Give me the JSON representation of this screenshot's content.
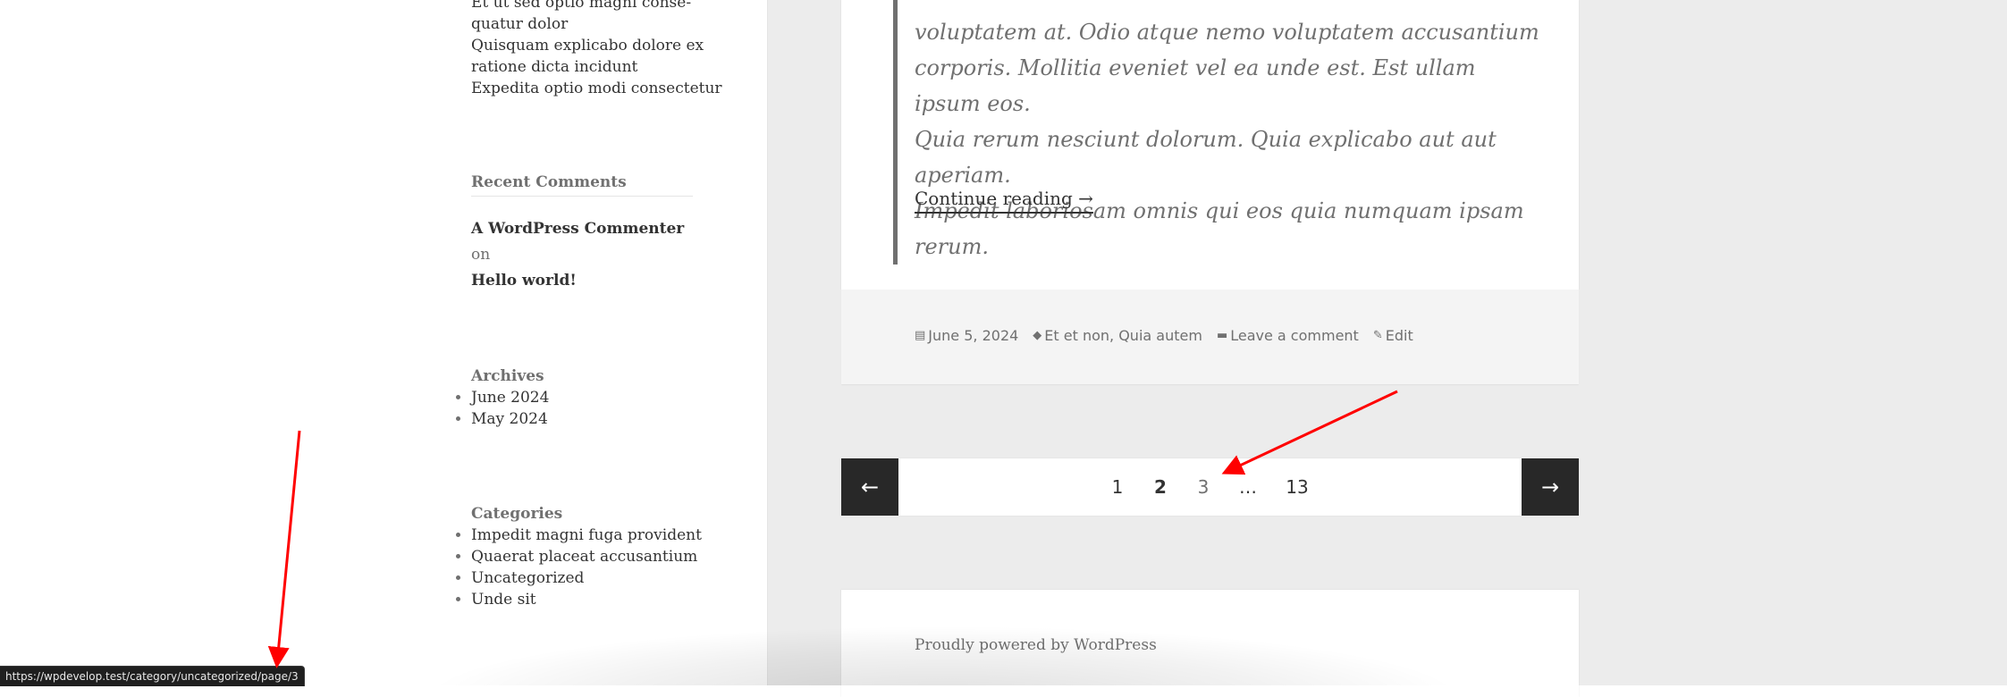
{
  "sidebar": {
    "recent_posts_tail": [
      "Et ut sed optio magni conse-",
      "quatur dolor",
      "Quisquam explicabo dolore ex",
      "ratione dicta incidunt",
      "Expedita optio modi consectetur"
    ],
    "recent_comments": {
      "title": "Recent Comments",
      "author": "A WordPress Commenter",
      "on_label": "on",
      "post": "Hello world!"
    },
    "archives": {
      "title": "Archives",
      "items": [
        "June 2024",
        "May 2024"
      ]
    },
    "categories": {
      "title": "Categories",
      "items": [
        "Impedit magni fuga provident",
        "Quaerat placeat accusantium",
        "Uncategorized",
        "Unde sit"
      ]
    }
  },
  "post": {
    "quote_lines": [
      "voluptatem at. Odio atque nemo voluptatem accusantium",
      "corporis. Mollitia eveniet vel ea unde est. Est ullam ipsum eos.",
      "Quia rerum nesciunt dolorum. Quia explicabo aut aut aperiam.",
      "Impedit laboriosam omnis qui eos quia numquam ipsam rerum."
    ],
    "continue_label": "Continue reading →",
    "meta": {
      "date": "June 5, 2024",
      "tags": "Et et non, Quia autem",
      "comments": "Leave a comment",
      "edit": "Edit",
      "icons": {
        "date": "calendar-icon",
        "tags": "tag-icon",
        "comments": "comment-icon",
        "edit": "pencil-icon"
      }
    }
  },
  "pagination": {
    "prev_icon": "←",
    "next_icon": "→",
    "pages": [
      {
        "label": "1",
        "state": "link"
      },
      {
        "label": "2",
        "state": "current"
      },
      {
        "label": "3",
        "state": "hover"
      },
      {
        "label": "…",
        "state": "dots"
      },
      {
        "label": "13",
        "state": "link"
      }
    ]
  },
  "footer": {
    "text": "Proudly powered by WordPress"
  },
  "status_bar": {
    "url": "https://wpdevelop.test/category/uncategorized/page/3"
  },
  "annotations": {
    "arrow_color": "#ff0000"
  }
}
